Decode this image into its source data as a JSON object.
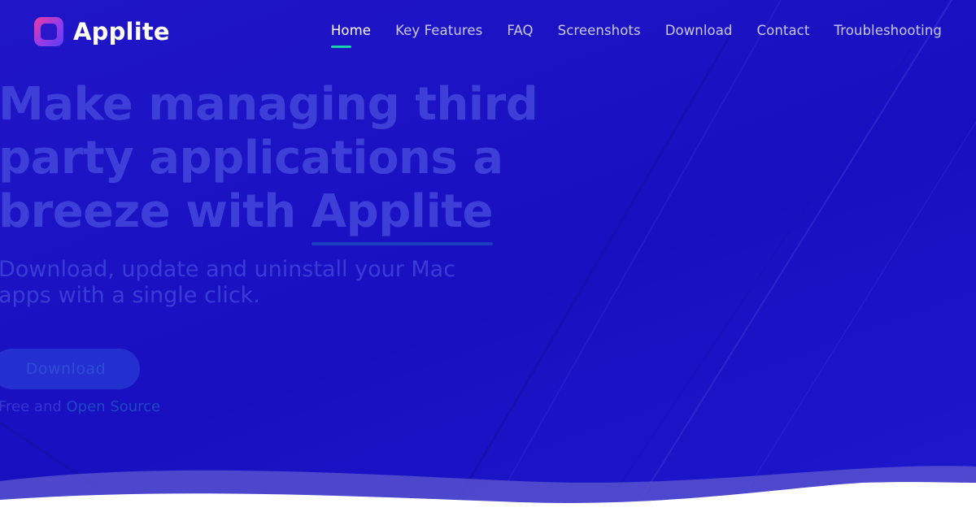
{
  "brand": {
    "name": "Applite",
    "logo_icon": "applite-logo-icon"
  },
  "nav": {
    "items": [
      {
        "label": "Home",
        "active": true
      },
      {
        "label": "Key Features",
        "active": false
      },
      {
        "label": "FAQ",
        "active": false
      },
      {
        "label": "Screenshots",
        "active": false
      },
      {
        "label": "Download",
        "active": false
      },
      {
        "label": "Contact",
        "active": false
      },
      {
        "label": "Troubleshooting",
        "active": false
      }
    ]
  },
  "hero": {
    "headline_line1": "Make managing third",
    "headline_line2": "party applications a",
    "headline_line3_prefix": "breeze with ",
    "headline_accent": "Applite",
    "subtitle": "Download, update and uninstall your Mac apps with a single click.",
    "cta_label": "Download",
    "note_prefix": "Free and ",
    "note_link": "Open Source"
  },
  "colors": {
    "background": "#1a14c4",
    "accent_underline": "#19d3a8",
    "wave_light": "#5a55cf",
    "wave_white": "#ffffff"
  }
}
